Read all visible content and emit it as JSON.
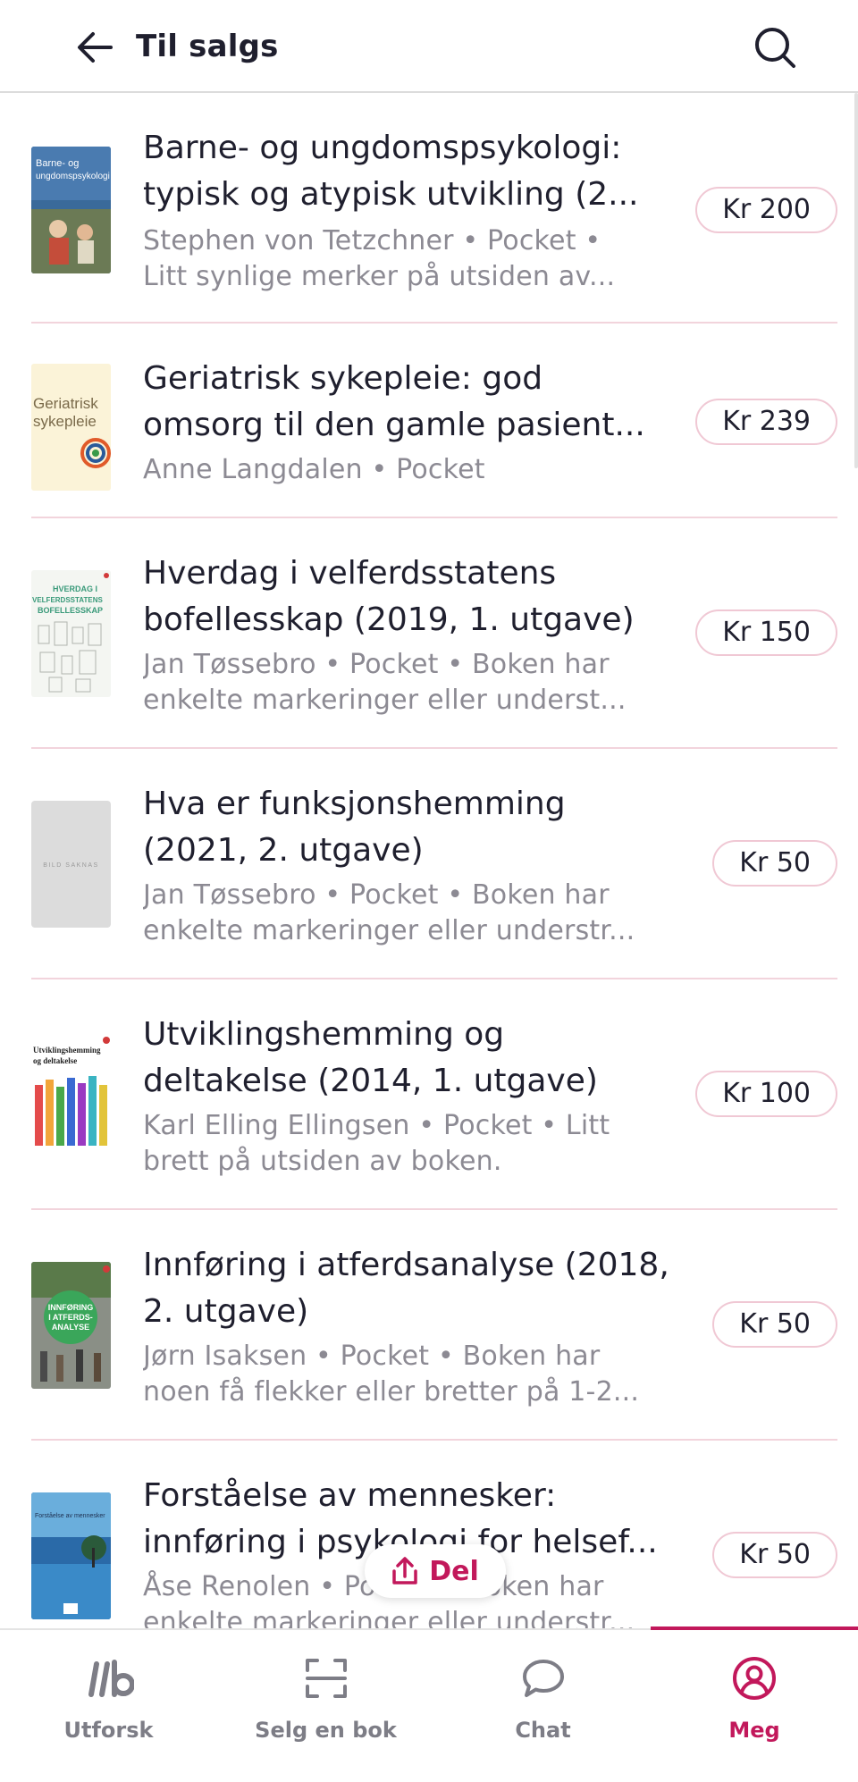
{
  "header": {
    "title": "Til salgs",
    "back_icon": "arrow-left-icon",
    "search_icon": "search-icon"
  },
  "listings": [
    {
      "title_lines": [
        "Barne- og ungdomspsykologi:",
        "typisk og atypisk utvikling (2..."
      ],
      "meta_lines": [
        "Stephen von Tetzchner • Pocket •",
        "Litt synlige merker på utsiden av..."
      ],
      "price": "Kr 200",
      "cover_text": [
        "Barne- og",
        "ungdomspsykologi"
      ]
    },
    {
      "title_lines": [
        "Geriatrisk sykepleie: god",
        "omsorg til den gamle pasient..."
      ],
      "meta_lines": [
        "Anne Langdalen • Pocket"
      ],
      "price": "Kr 239",
      "cover_text": [
        "Geriatrisk",
        "sykepleie"
      ]
    },
    {
      "title_lines": [
        "Hverdag i velferdsstatens",
        "bofellesskap (2019, 1. utgave)"
      ],
      "meta_lines": [
        "Jan Tøssebro • Pocket • Boken har",
        "enkelte markeringer eller underst..."
      ],
      "price": "Kr 150",
      "cover_text": [
        "HVERDAG I",
        "VELFERDSSTATENS",
        "BOFELLESSKAP"
      ]
    },
    {
      "title_lines": [
        "Hva er funksjonshemming",
        "(2021, 2. utgave)"
      ],
      "meta_lines": [
        "Jan Tøssebro • Pocket • Boken har",
        "enkelte markeringer eller understr..."
      ],
      "price": "Kr 50",
      "cover_text": [
        "BILD SAKNAS"
      ]
    },
    {
      "title_lines": [
        "Utviklingshemming og",
        "deltakelse (2014, 1. utgave)"
      ],
      "meta_lines": [
        "Karl Elling Ellingsen • Pocket • Litt",
        "brett på utsiden av boken."
      ],
      "price": "Kr 100",
      "cover_text": [
        "Utviklingshemming",
        "og deltakelse"
      ]
    },
    {
      "title_lines": [
        "Innføring i atferdsanalyse (2018,",
        "2. utgave)"
      ],
      "meta_lines": [
        "Jørn Isaksen • Pocket • Boken har",
        "noen få flekker eller bretter på 1-2..."
      ],
      "price": "Kr 50",
      "cover_text": [
        "INNFØRING",
        "I ATFERDS-",
        "ANALYSE"
      ]
    },
    {
      "title_lines": [
        "Forståelse av mennesker:",
        "innføring i psykologi for helsef..."
      ],
      "meta_lines": [
        "Åse Renolen • Pocket • Boken har",
        "enkelte markeringer eller understr..."
      ],
      "price": "Kr 50",
      "cover_text": [
        "Forståelse av mennesker"
      ]
    }
  ],
  "share": {
    "label": "Del",
    "icon": "share-icon"
  },
  "bottom_nav": {
    "items": [
      {
        "label": "Utforsk",
        "icon": "unibok-logo-icon"
      },
      {
        "label": "Selg en bok",
        "icon": "scan-icon"
      },
      {
        "label": "Chat",
        "icon": "chat-bubble-icon"
      },
      {
        "label": "Meg",
        "icon": "profile-icon",
        "active": true
      }
    ]
  },
  "colors": {
    "accent": "#c2185b",
    "divider": "#f2d4dc",
    "price_border": "#f0c8d4",
    "meta_text": "#8c8a93"
  }
}
